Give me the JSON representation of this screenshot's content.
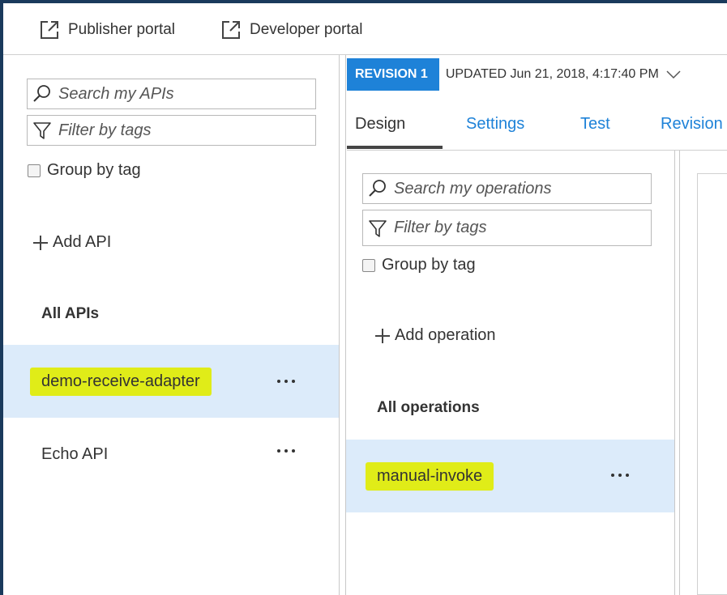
{
  "toolbar": {
    "publisher_portal_label": "Publisher portal",
    "developer_portal_label": "Developer portal"
  },
  "api_panel": {
    "search_placeholder": "Search my APIs",
    "filter_placeholder": "Filter by tags",
    "group_by_tag_label": "Group by tag",
    "add_api_label": "Add API",
    "section_title": "All APIs",
    "apis": [
      {
        "label": "demo-receive-adapter",
        "selected": true,
        "highlighted": true
      },
      {
        "label": "Echo API",
        "selected": false,
        "highlighted": false
      }
    ]
  },
  "revision_bar": {
    "badge": "REVISION 1",
    "updated_text": "UPDATED Jun 21, 2018, 4:17:40 PM"
  },
  "tabs": [
    {
      "label": "Design",
      "active": true
    },
    {
      "label": "Settings",
      "active": false
    },
    {
      "label": "Test",
      "active": false
    },
    {
      "label": "Revision",
      "active": false
    }
  ],
  "operations_panel": {
    "search_placeholder": "Search my operations",
    "filter_placeholder": "Filter by tags",
    "group_by_tag_label": "Group by tag",
    "add_operation_label": "Add operation",
    "section_title": "All operations",
    "operations": [
      {
        "label": "manual-invoke",
        "selected": true,
        "highlighted": true
      }
    ]
  },
  "colors": {
    "accent": "#1e82d8",
    "selected_row": "#dcebfa",
    "highlight": "#e0ec18",
    "frame": "#1a3a5c"
  }
}
